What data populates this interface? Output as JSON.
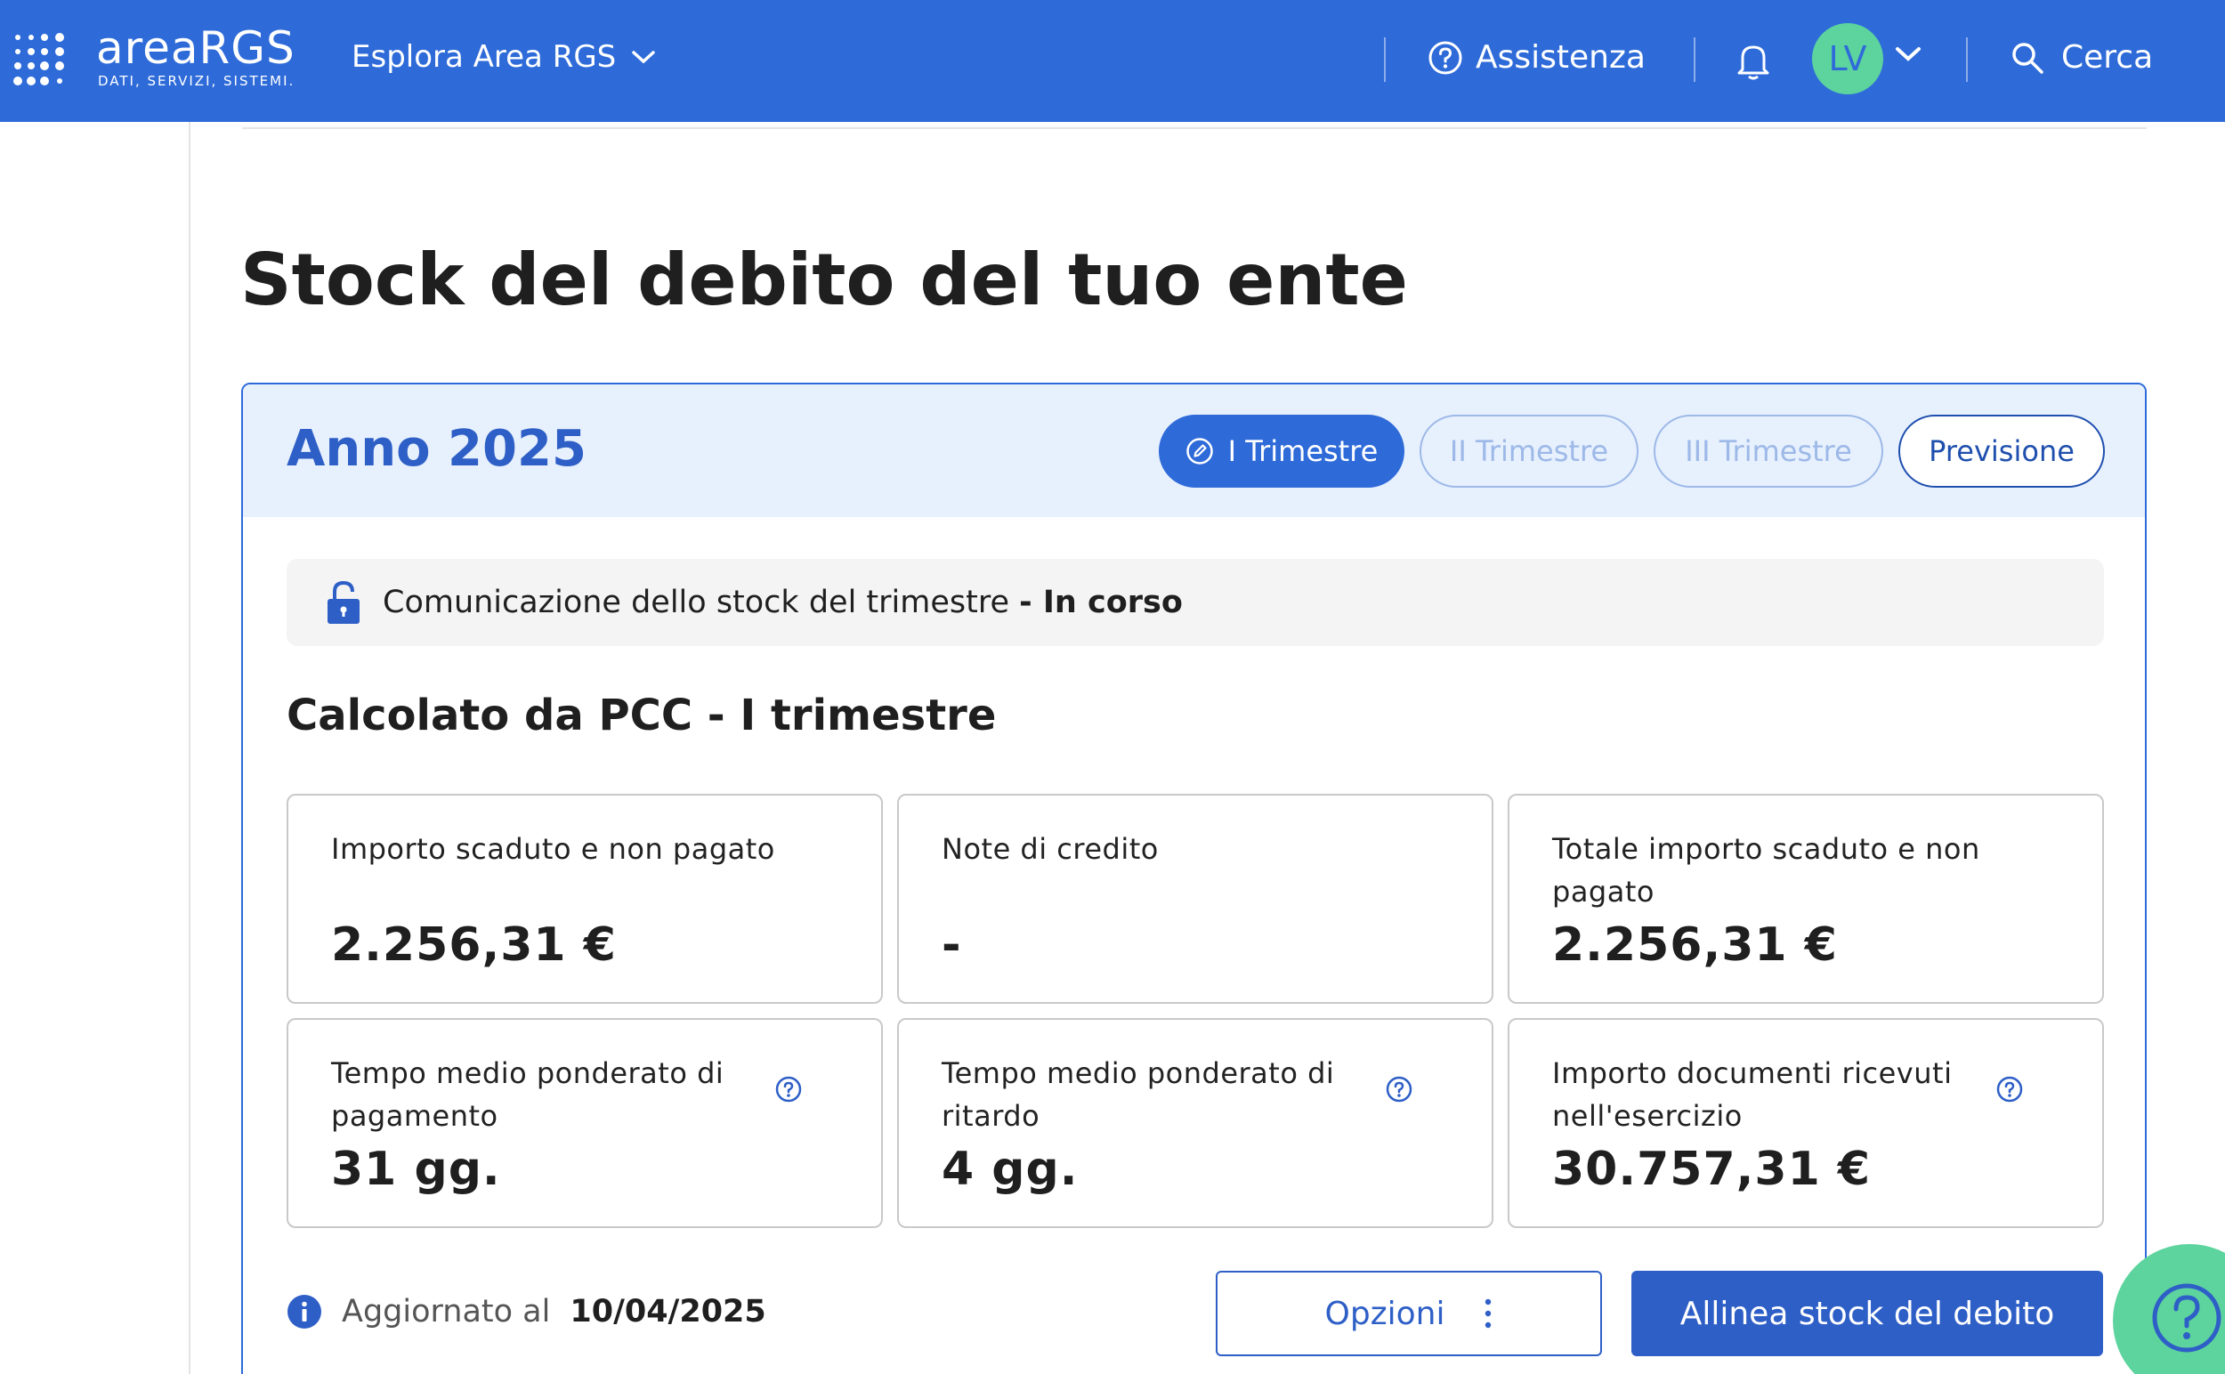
{
  "header": {
    "brand": "areaRGS",
    "brand_sub": "DATI, SERVIZI, SISTEMI.",
    "explore_label": "Esplora Area RGS",
    "help_label": "Assistenza",
    "avatar_initials": "LV",
    "search_label": "Cerca"
  },
  "page": {
    "title": "Stock del debito del tuo ente"
  },
  "card": {
    "year_title": "Anno 2025",
    "tabs": [
      {
        "label": "I Trimestre",
        "state": "active"
      },
      {
        "label": "II Trimestre",
        "state": "disabled"
      },
      {
        "label": "III Trimestre",
        "state": "disabled"
      },
      {
        "label": "Previsione",
        "state": "outline"
      }
    ],
    "status": {
      "text": "Comunicazione dello stock del trimestre",
      "strong": "- In corso"
    },
    "section_title": "Calcolato da PCC - I trimestre",
    "metrics": [
      {
        "label": "Importo scaduto e non pagato",
        "value": "2.256,31 €",
        "has_help": false
      },
      {
        "label": "Note di credito",
        "value": "-",
        "has_help": false
      },
      {
        "label": "Totale importo scaduto e non pagato",
        "value": "2.256,31 €",
        "has_help": false
      },
      {
        "label": "Tempo medio ponderato di pagamento",
        "value": "31 gg.",
        "has_help": true
      },
      {
        "label": "Tempo medio ponderato di ritardo",
        "value": "4 gg.",
        "has_help": true
      },
      {
        "label": "Importo documenti ricevuti nell'esercizio",
        "value": "30.757,31 €",
        "has_help": true
      }
    ],
    "updated_label": "Aggiornato al",
    "updated_date": "10/04/2025",
    "options_button": "Opzioni",
    "align_button": "Allinea stock del debito"
  },
  "colors": {
    "header_bg": "#2e6bd9",
    "primary": "#2e5fc7",
    "avatar_bg": "#5dd39e",
    "card_head_bg": "#e7f0fd"
  },
  "icons": [
    "grid-dots-icon",
    "chevron-down-icon",
    "question-circle-icon",
    "bell-icon",
    "search-icon",
    "lock-open-icon",
    "info-icon",
    "pencil-circle-icon",
    "kebab-icon"
  ]
}
